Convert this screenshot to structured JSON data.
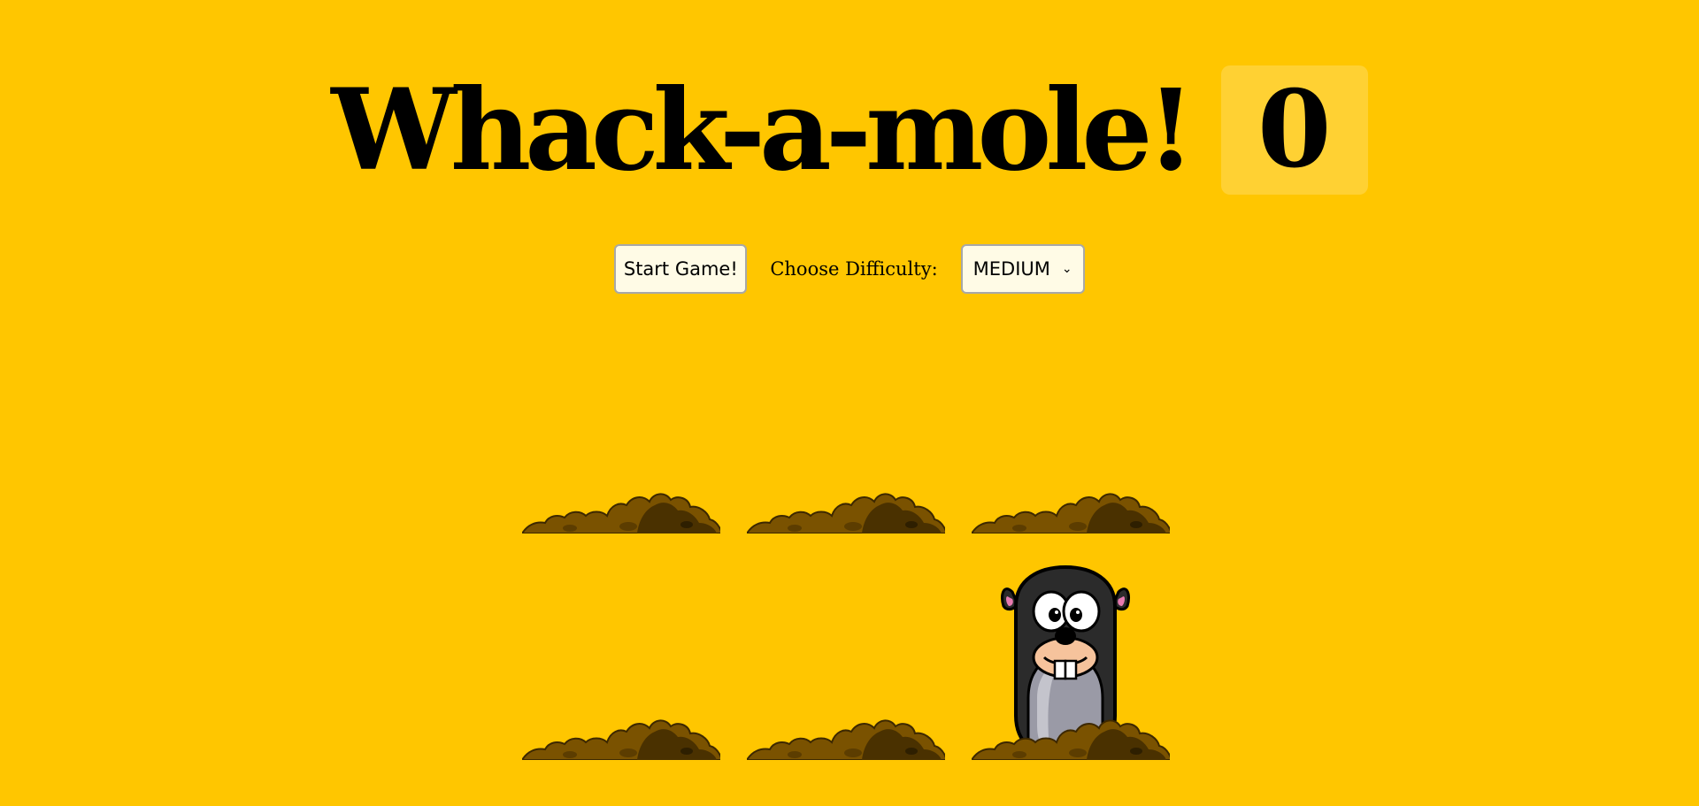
{
  "header": {
    "title": "Whack-a-mole!",
    "score": "0"
  },
  "controls": {
    "start_label": "Start Game!",
    "difficulty_label": "Choose Difficulty:",
    "difficulty_value": "MEDIUM"
  },
  "board": {
    "holes": [
      {
        "mole_visible": false
      },
      {
        "mole_visible": false
      },
      {
        "mole_visible": false
      },
      {
        "mole_visible": false
      },
      {
        "mole_visible": false
      },
      {
        "mole_visible": true
      }
    ]
  },
  "colors": {
    "background": "#ffc600",
    "dirt_light": "#7a5200",
    "dirt_dark": "#4a3100",
    "mole_body": "#2b2b2b"
  }
}
